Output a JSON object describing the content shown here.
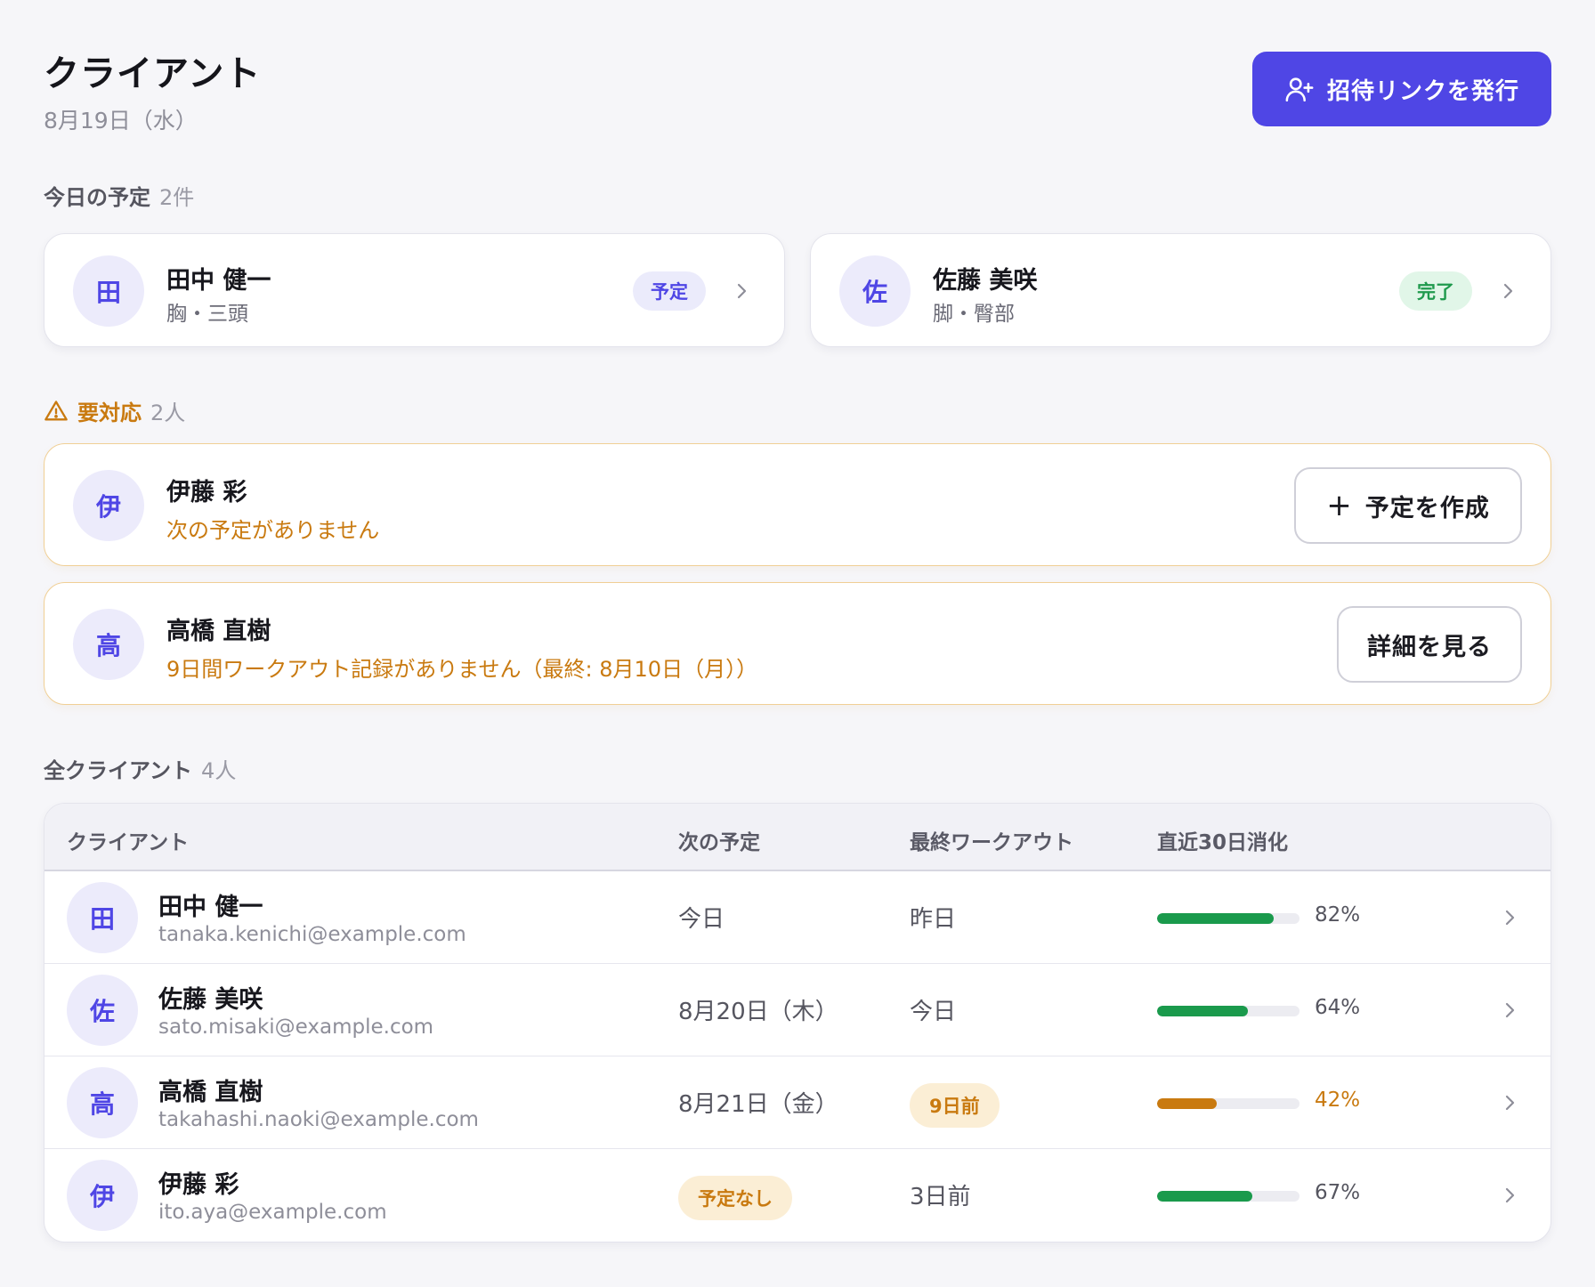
{
  "header": {
    "title": "クライアント",
    "date": "8月19日（水）",
    "invite_label": "招待リンクを発行",
    "invite_icon": "user-plus-icon"
  },
  "today": {
    "heading": "今日の予定",
    "count": "2件",
    "cards": [
      {
        "initial": "田",
        "name": "田中 健一",
        "focus": "胸・三頭",
        "status": "予定"
      },
      {
        "initial": "佐",
        "name": "佐藤 美咲",
        "focus": "脚・臀部",
        "status": "完了"
      }
    ]
  },
  "attention": {
    "heading": "要対応",
    "count": "2人",
    "icon": "warning-triangle-icon",
    "items": [
      {
        "initial": "伊",
        "name": "伊藤 彩",
        "message": "次の予定がありません",
        "action": "予定を作成",
        "action_icon": "plus-icon"
      },
      {
        "initial": "高",
        "name": "高橋 直樹",
        "message": "9日間ワークアウト記録がありません（最終: 8月10日（月））",
        "action": "詳細を見る"
      }
    ]
  },
  "clients": {
    "heading": "全クライアント",
    "count": "4人",
    "columns": [
      "クライアント",
      "次の予定",
      "最終ワークアウト",
      "直近30日消化"
    ],
    "rows": [
      {
        "initial": "田",
        "name": "田中 健一",
        "email": "tanaka.kenichi@example.com",
        "next": "今日",
        "last": "昨日",
        "progress": 82,
        "progress_label": "82%"
      },
      {
        "initial": "佐",
        "name": "佐藤 美咲",
        "email": "sato.misaki@example.com",
        "next": "8月20日（木）",
        "last": "今日",
        "progress": 64,
        "progress_label": "64%"
      },
      {
        "initial": "高",
        "name": "高橋 直樹",
        "email": "takahashi.naoki@example.com",
        "next": "8月21日（金）",
        "last": "9日前",
        "progress": 42,
        "progress_label": "42%"
      },
      {
        "initial": "伊",
        "name": "伊藤 彩",
        "email": "ito.aya@example.com",
        "next": "予定なし",
        "last": "3日前",
        "progress": 67,
        "progress_label": "67%"
      }
    ]
  },
  "colors": {
    "accent": "#4f46e5",
    "warning": "#c97a10",
    "success": "#1f9a4d",
    "progress_good": "#1a9a4c",
    "progress_warn": "#c97a10"
  }
}
